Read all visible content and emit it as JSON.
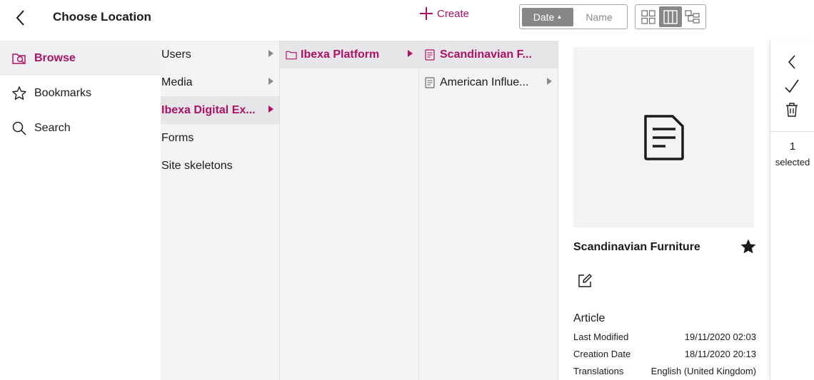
{
  "header": {
    "title": "Choose Location",
    "create_label": "Create",
    "sort": {
      "date_label": "Date",
      "name_label": "Name",
      "active": "date"
    },
    "views": [
      "grid-view",
      "columns-view",
      "tree-view"
    ]
  },
  "sidebar": {
    "items": [
      {
        "label": "Browse",
        "icon": "browse-icon",
        "active": true
      },
      {
        "label": "Bookmarks",
        "icon": "star-outline-icon",
        "active": false
      },
      {
        "label": "Search",
        "icon": "search-icon",
        "active": false
      }
    ]
  },
  "columns": {
    "col1": [
      {
        "label": "Users",
        "selected": false,
        "has_children": true
      },
      {
        "label": "Media",
        "selected": false,
        "has_children": true
      },
      {
        "label": "Ibexa Digital Ex...",
        "selected": true,
        "has_children": true
      },
      {
        "label": "Forms",
        "selected": false,
        "has_children": false
      },
      {
        "label": "Site skeletons",
        "selected": false,
        "has_children": false
      }
    ],
    "col2": [
      {
        "label": "Ibexa Platform",
        "selected": true,
        "has_children": true,
        "icon": "folder-icon"
      }
    ],
    "col3": [
      {
        "label": "Scandinavian F...",
        "selected": true,
        "has_children": false,
        "icon": "article-icon"
      },
      {
        "label": "American Influe...",
        "selected": false,
        "has_children": true,
        "icon": "article-icon"
      }
    ]
  },
  "preview": {
    "name": "Scandinavian Furniture",
    "type": "Article",
    "meta": [
      {
        "key": "Last Modified",
        "value": "19/11/2020 02:03"
      },
      {
        "key": "Creation Date",
        "value": "18/11/2020 20:13"
      },
      {
        "key": "Translations",
        "value": "English (United Kingdom)"
      }
    ]
  },
  "rail": {
    "selected_count": "1",
    "selected_label": "selected"
  },
  "colors": {
    "accent": "#ae1164",
    "column_bg": "#f3f3f3",
    "selected_row_bg": "#e6e6e8",
    "toggle_active": "#878787"
  }
}
